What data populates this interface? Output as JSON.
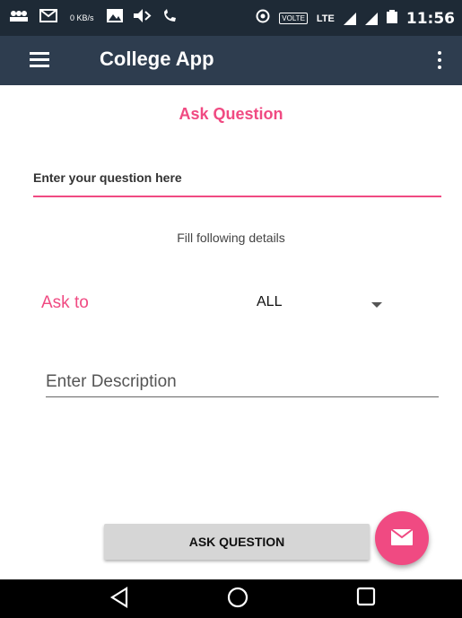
{
  "status_bar": {
    "left_glyphs": [
      "👥",
      "✉",
      "🖼",
      "◀"
    ],
    "net_speed": "0 KB/s",
    "volte": "VOLTE",
    "lte": "LTE",
    "time": "11:56"
  },
  "app_bar": {
    "title": "College App",
    "menu_icon": "hamburger-menu-icon",
    "more_icon": "more-vert-icon"
  },
  "form": {
    "section_title": "Ask Question",
    "question_placeholder": "Enter your question here",
    "fill_details_text": "Fill following details",
    "ask_to_label": "Ask to",
    "ask_to_selected": "ALL",
    "description_placeholder": "Enter Description",
    "submit_label": "ASK QUESTION"
  },
  "fab": {
    "icon": "mail-icon"
  },
  "nav_bar": {
    "back": "back-icon",
    "home": "home-icon",
    "recents": "recents-icon"
  },
  "colors": {
    "status_bar": "#1e2a36",
    "app_bar": "#2e3d4f",
    "accent": "#f04a82",
    "button": "#d6d6d6",
    "nav_bar": "#000000"
  }
}
